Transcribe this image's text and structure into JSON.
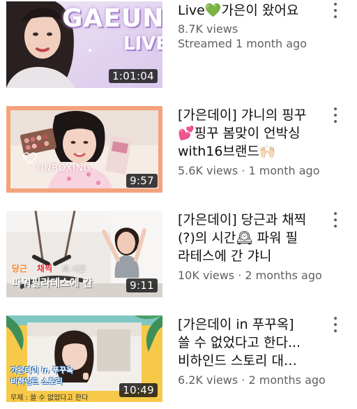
{
  "videos": [
    {
      "title_lines": [
        "Live💚가은이 왔어요"
      ],
      "views": "8.7K views",
      "date": "Streamed 1 month ago",
      "duration": "1:01:04",
      "thumb_text": [
        "GAEUN",
        "LIVE"
      ]
    },
    {
      "title_lines": [
        "[가은데이] 갸니의 핑꾸",
        "💕핑꾸 봄맞이 언박싱",
        "with16브랜드🙌🏻"
      ],
      "views": "5.6K views",
      "date": "1 month ago",
      "duration": "9:57",
      "thumb_text": [
        "UNBOXING"
      ]
    },
    {
      "title_lines": [
        "[가은데이] 당근과 채찍",
        "(?)의 시간🕰 파워 필",
        "라테스에 간 갸니"
      ],
      "views": "10K views",
      "date": "2 months ago",
      "duration": "9:11",
      "thumb_text": [
        "당근",
        "채찍",
        "의 시간",
        "파워필라테스에 간"
      ]
    },
    {
      "title_lines": [
        "[가은데이 in 푸꾸옥]",
        "쓸 수 없었다고 한다...",
        "비하인드 스토리 대…"
      ],
      "views": "6.2K views",
      "date": "2 months ago",
      "duration": "10:49",
      "thumb_text": [
        "가은데이 in 푸꾸옥",
        "비하인드 스토리",
        "무제 : 쓸 수 없었다고 한다"
      ]
    }
  ],
  "stats_separator": " · ",
  "icons": {
    "more": "more-vert-icon"
  },
  "colors": {
    "stats_text": "#606060",
    "title_text": "#0f0f0f",
    "thumb2_border": "#f4a27b",
    "thumb4_border": "#f7c948"
  }
}
